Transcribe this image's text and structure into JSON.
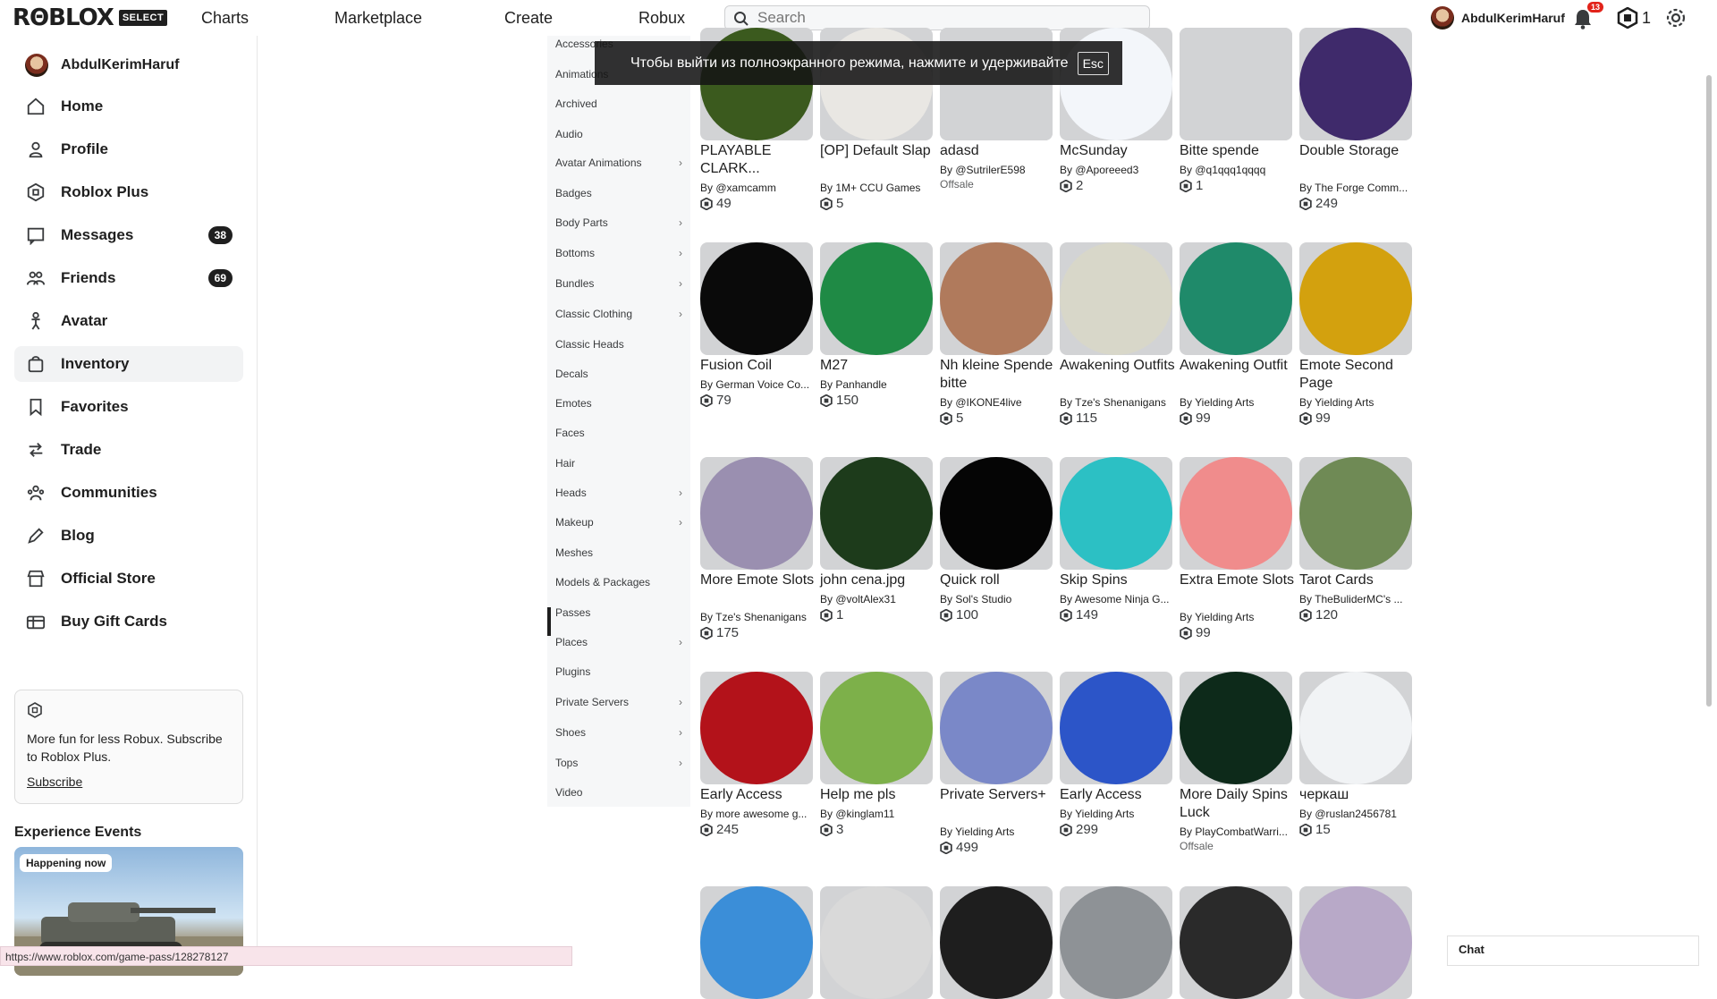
{
  "topbar": {
    "logo_text": "RΘBLOX",
    "logo_badge": "SELECT",
    "nav": [
      "Charts",
      "Marketplace",
      "Create",
      "Robux"
    ],
    "search_placeholder": "Search",
    "username": "AbdulKerimHaruf",
    "notification_count": "13",
    "robux_count": "1"
  },
  "sidebar": {
    "username": "AbdulKerimHaruf",
    "items": [
      {
        "label": "Home",
        "icon": "home-icon"
      },
      {
        "label": "Profile",
        "icon": "profile-icon"
      },
      {
        "label": "Roblox Plus",
        "icon": "roblox-plus-icon"
      },
      {
        "label": "Messages",
        "icon": "messages-icon",
        "badge": "38"
      },
      {
        "label": "Friends",
        "icon": "friends-icon",
        "badge": "69"
      },
      {
        "label": "Avatar",
        "icon": "avatar-icon"
      },
      {
        "label": "Inventory",
        "icon": "inventory-icon",
        "active": true
      },
      {
        "label": "Favorites",
        "icon": "favorites-icon"
      },
      {
        "label": "Trade",
        "icon": "trade-icon"
      },
      {
        "label": "Communities",
        "icon": "communities-icon"
      },
      {
        "label": "Blog",
        "icon": "blog-icon"
      },
      {
        "label": "Official Store",
        "icon": "store-icon"
      },
      {
        "label": "Buy Gift Cards",
        "icon": "gift-card-icon"
      }
    ],
    "promo_text": "More fun for less Robux. Subscribe to Roblox Plus.",
    "promo_link": "Subscribe",
    "events_title": "Experience Events",
    "event_badge": "Happening now"
  },
  "categories": [
    {
      "label": "Accessories",
      "chevron": false
    },
    {
      "label": "Animations",
      "chevron": false
    },
    {
      "label": "Archived",
      "chevron": false
    },
    {
      "label": "Audio",
      "chevron": false
    },
    {
      "label": "Avatar Animations",
      "chevron": true
    },
    {
      "label": "Badges",
      "chevron": false
    },
    {
      "label": "Body Parts",
      "chevron": true
    },
    {
      "label": "Bottoms",
      "chevron": true
    },
    {
      "label": "Bundles",
      "chevron": true
    },
    {
      "label": "Classic Clothing",
      "chevron": true
    },
    {
      "label": "Classic Heads",
      "chevron": false
    },
    {
      "label": "Decals",
      "chevron": false
    },
    {
      "label": "Emotes",
      "chevron": false
    },
    {
      "label": "Faces",
      "chevron": false
    },
    {
      "label": "Hair",
      "chevron": false
    },
    {
      "label": "Heads",
      "chevron": true
    },
    {
      "label": "Makeup",
      "chevron": true
    },
    {
      "label": "Meshes",
      "chevron": false
    },
    {
      "label": "Models & Packages",
      "chevron": false
    },
    {
      "label": "Passes",
      "chevron": false,
      "active": true
    },
    {
      "label": "Places",
      "chevron": true
    },
    {
      "label": "Plugins",
      "chevron": false
    },
    {
      "label": "Private Servers",
      "chevron": true
    },
    {
      "label": "Shoes",
      "chevron": true
    },
    {
      "label": "Tops",
      "chevron": true
    },
    {
      "label": "Video",
      "chevron": false
    }
  ],
  "items": [
    {
      "title": "PLAYABLE CLARK...",
      "creator": "@xamcamm",
      "price": "49",
      "color": "#3b5a1e"
    },
    {
      "title": "[OP] Default Slap",
      "creator": "1M+ CCU Games",
      "price": "5",
      "color": "#e9e7e3"
    },
    {
      "title": "adasd",
      "creator": "@SutrilerE598",
      "offsale": "Offsale",
      "color": "#d2d3d5"
    },
    {
      "title": "McSunday",
      "creator": "@Aporeeed3",
      "price": "2",
      "color": "#f3f6fa"
    },
    {
      "title": "Bitte spende",
      "creator": "@q1qqq1qqqq",
      "price": "1",
      "color": "#d2d3d5"
    },
    {
      "title": "Double Storage",
      "creator": "The Forge Comm...",
      "price": "249",
      "color": "#3f2a6b"
    },
    {
      "title": "Fusion Coil",
      "creator": "German Voice Co...",
      "price": "79",
      "color": "#0a0a0a"
    },
    {
      "title": "M27",
      "creator": "Panhandle",
      "price": "150",
      "color": "#1f8a45"
    },
    {
      "title": "Nh kleine Spende bitte",
      "creator": "@IKONE4live",
      "price": "5",
      "color": "#b07a5c"
    },
    {
      "title": "Awakening Outfits",
      "creator": "Tze's Shenanigans",
      "price": "115",
      "color": "#d8d7c9"
    },
    {
      "title": "Awakening Outfit",
      "creator": "Yielding Arts",
      "price": "99",
      "color": "#1f8a6a"
    },
    {
      "title": "Emote Second Page",
      "creator": "Yielding Arts",
      "price": "99",
      "color": "#d3a10e"
    },
    {
      "title": "More Emote Slots",
      "creator": "Tze's Shenanigans",
      "price": "175",
      "color": "#9a8fb0"
    },
    {
      "title": "john cena.jpg",
      "creator": "@voltAlex31",
      "price": "1",
      "color": "#1d3b1b"
    },
    {
      "title": "Quick roll",
      "creator": "Sol's Studio",
      "price": "100",
      "color": "#050505"
    },
    {
      "title": "Skip Spins",
      "creator": "Awesome Ninja G...",
      "price": "149",
      "color": "#2cc0c4"
    },
    {
      "title": "Extra Emote Slots",
      "creator": "Yielding Arts",
      "price": "99",
      "color": "#f08c8c"
    },
    {
      "title": "Tarot Cards",
      "creator": "TheBuliderMC's ...",
      "price": "120",
      "color": "#6f8a55"
    },
    {
      "title": "Early Access",
      "creator": "more awesome g...",
      "price": "245",
      "color": "#b3121a"
    },
    {
      "title": "Help me pls",
      "creator": "@kinglam11",
      "price": "3",
      "color": "#7db04a"
    },
    {
      "title": "Private Servers+",
      "creator": "Yielding Arts",
      "price": "499",
      "color": "#7a88c8"
    },
    {
      "title": "Early Access",
      "creator": "Yielding Arts",
      "price": "299",
      "color": "#2c55c8"
    },
    {
      "title": "More Daily Spins Luck",
      "creator": "PlayCombatWarri...",
      "offsale": "Offsale",
      "color": "#0d2a1a"
    },
    {
      "title": "черкаш",
      "creator": "@ruslan2456781",
      "price": "15",
      "color": "#f1f3f5"
    },
    {
      "title": "",
      "creator": "",
      "color": "#3b8ed8"
    },
    {
      "title": "",
      "creator": "",
      "color": "#d9d9d9"
    },
    {
      "title": "",
      "creator": "",
      "color": "#1e1e1e"
    },
    {
      "title": "",
      "creator": "",
      "color": "#8e9296"
    },
    {
      "title": "",
      "creator": "",
      "color": "#2a2a2a"
    },
    {
      "title": "",
      "creator": "",
      "color": "#b8a9c8"
    }
  ],
  "overlay": {
    "message": "Чтобы выйти из полноэкранного режима, нажмите и удерживайте",
    "key": "Esc"
  },
  "status_url": "https://www.roblox.com/game-pass/128278127",
  "chat_label": "Chat"
}
